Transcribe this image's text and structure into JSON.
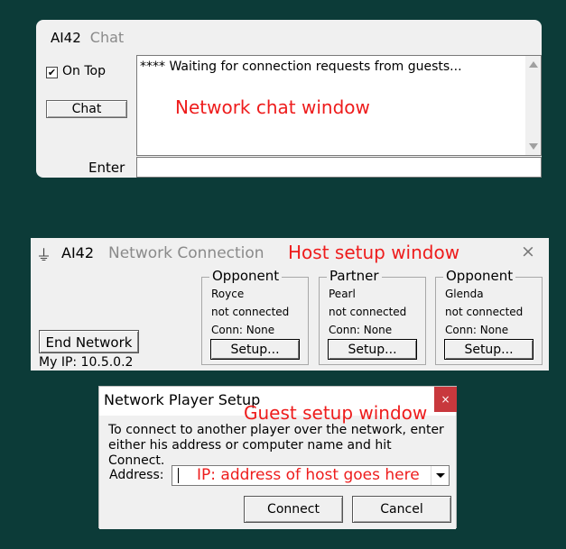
{
  "chat_window": {
    "app_name": "AI42",
    "title": "Chat",
    "on_top_label": "On Top",
    "on_top_checked": "✔",
    "chat_button": "Chat",
    "log_text": "**** Waiting for connection requests from guests...",
    "annotation": "Network chat window",
    "enter_label": "Enter",
    "enter_value": ""
  },
  "network_window": {
    "app_name": "AI42",
    "title": "Network Connection",
    "annotation": "Host setup window",
    "close_icon": "×",
    "groups": [
      {
        "label": "Opponent",
        "name": "Royce",
        "status": "not connected",
        "conn": "Conn: None",
        "setup": "Setup..."
      },
      {
        "label": "Partner",
        "name": "Pearl",
        "status": "not connected",
        "conn": "Conn: None",
        "setup": "Setup..."
      },
      {
        "label": "Opponent",
        "name": "Glenda",
        "status": "not connected",
        "conn": "Conn: None",
        "setup": "Setup..."
      }
    ],
    "end_network_button": "End Network",
    "my_ip": "My IP: 10.5.0.2"
  },
  "guest_window": {
    "title": "Network Player Setup",
    "annotation": "Guest setup window",
    "close_icon": "×",
    "description": "To connect to another player over the network, enter either his address or computer name and hit Connect.",
    "address_label": "Address:",
    "address_value": "IP: address of host goes here",
    "connect_button": "Connect",
    "cancel_button": "Cancel"
  },
  "colors": {
    "background": "#0c3b38",
    "annotation": "#ee1c1c",
    "close_red": "#c8383d"
  }
}
